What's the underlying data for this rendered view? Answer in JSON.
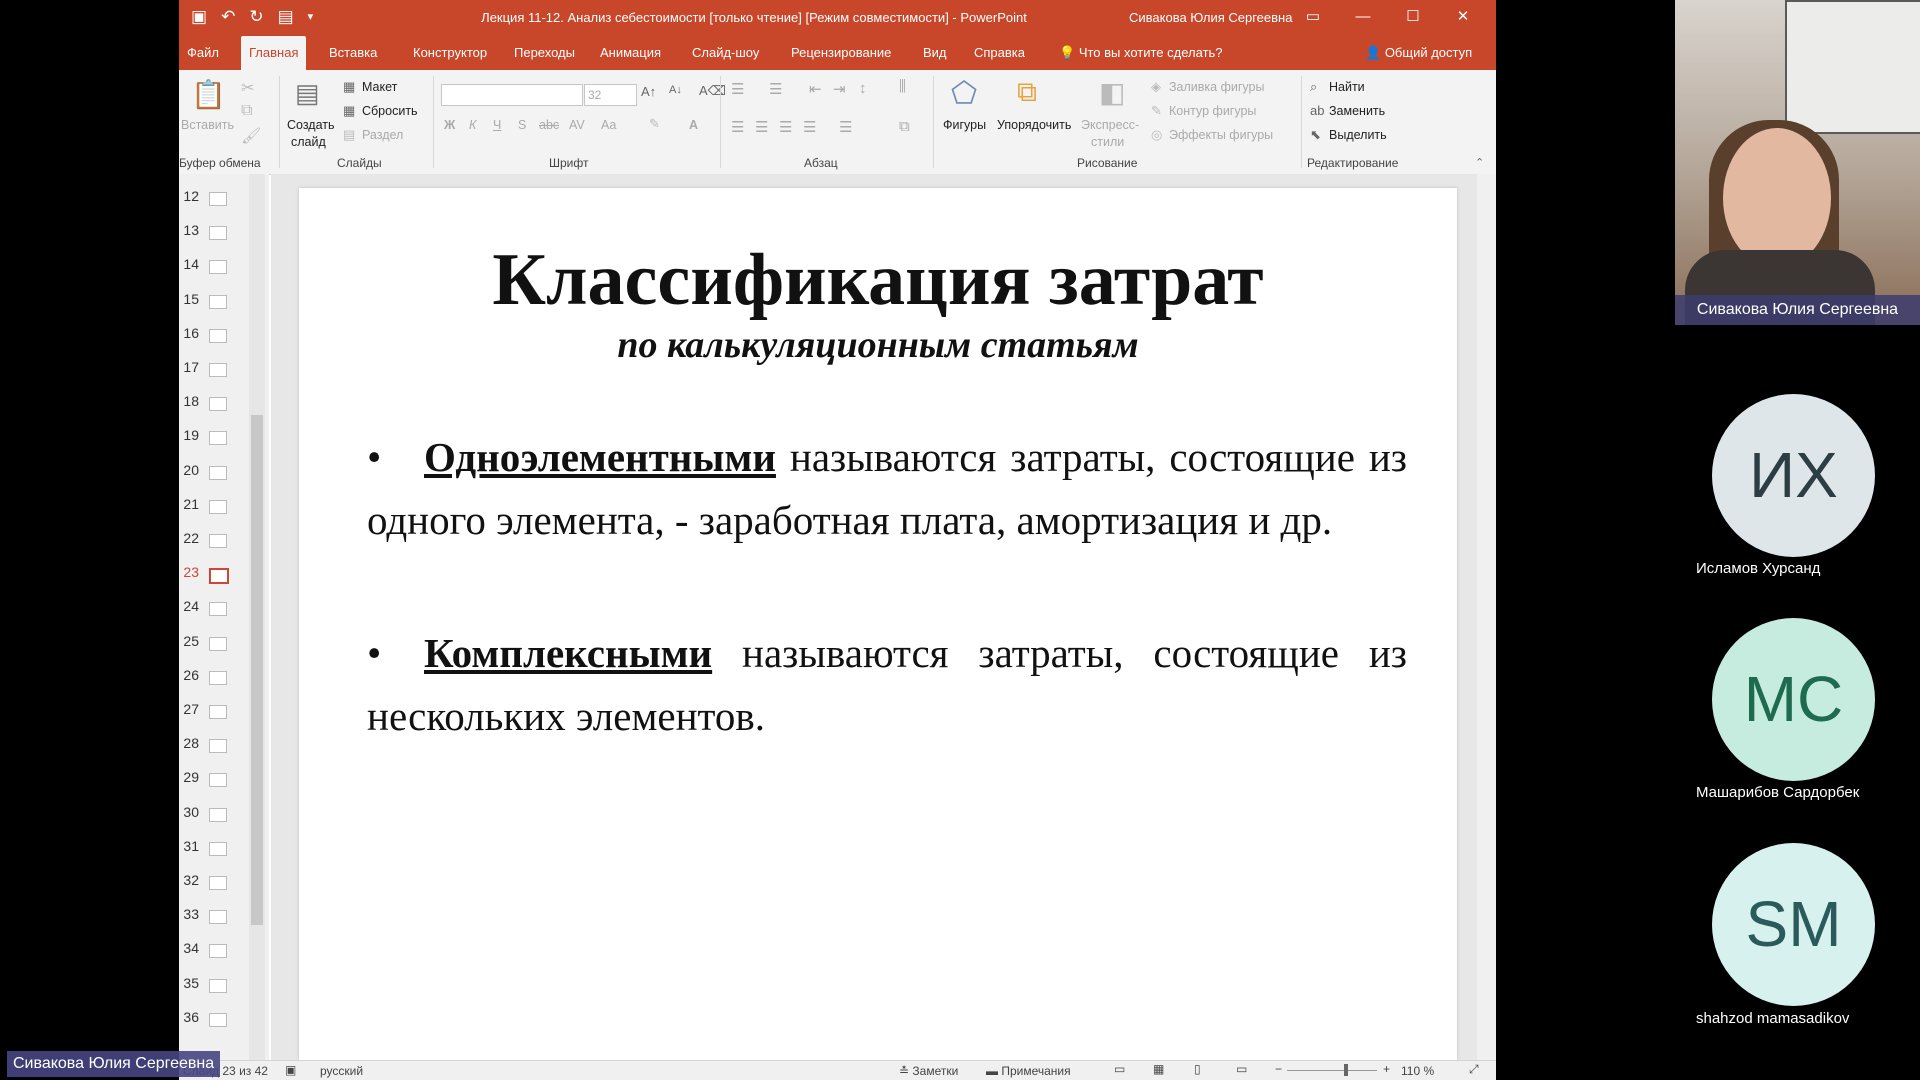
{
  "window": {
    "title": "Лекция 11-12. Анализ себестоимости [только чтение] [Режим совместимости]  -  PowerPoint",
    "user": "Сивакова Юлия Сергеевна",
    "brand_color": "#c8472b"
  },
  "menu": {
    "tabs": [
      "Файл",
      "Главная",
      "Вставка",
      "Конструктор",
      "Переходы",
      "Анимация",
      "Слайд-шоу",
      "Рецензирование",
      "Вид",
      "Справка"
    ],
    "active": "Главная",
    "tell_me": "Что вы хотите сделать?",
    "share": "Общий доступ"
  },
  "ribbon": {
    "clipboard": {
      "paste": "Вставить",
      "label": "Буфер обмена"
    },
    "slides": {
      "new_slide_1": "Создать",
      "new_slide_2": "слайд",
      "layout": "Макет",
      "reset": "Сбросить",
      "section": "Раздел",
      "label": "Слайды"
    },
    "font": {
      "size": "32",
      "label": "Шрифт",
      "bold": "Ж",
      "italic": "К",
      "underline": "Ч",
      "shadow": "S",
      "strike": "abc",
      "spacing": "AV",
      "case": "Aa",
      "color": "A"
    },
    "paragraph": {
      "label": "Абзац"
    },
    "drawing": {
      "shapes": "Фигуры",
      "arrange": "Упорядочить",
      "quick_styles_1": "Экспресс-",
      "quick_styles_2": "стили",
      "fill": "Заливка фигуры",
      "outline": "Контур фигуры",
      "effects": "Эффекты фигуры",
      "label": "Рисование"
    },
    "editing": {
      "find": "Найти",
      "replace": "Заменить",
      "select": "Выделить",
      "label": "Редактирование"
    }
  },
  "thumbnails": {
    "numbers": [
      "12",
      "13",
      "14",
      "15",
      "16",
      "17",
      "18",
      "19",
      "20",
      "21",
      "22",
      "23",
      "24",
      "25",
      "26",
      "27",
      "28",
      "29",
      "30",
      "31",
      "32",
      "33",
      "34",
      "35",
      "36"
    ],
    "selected": "23"
  },
  "slide": {
    "title": "Классификация затрат",
    "subtitle": "по калькуляционным статьям",
    "bullet1_term": "Одноэлементными",
    "bullet1_text": "называются затраты, состоящие из одного элемента, - заработная плата, амортизация и др.",
    "bullet2_term": "Комплексными",
    "bullet2_text": "называются затраты, состоящие из нескольких элементов."
  },
  "status": {
    "slide_of": "Слайд 23 из 42",
    "language": "русский",
    "notes": "Заметки",
    "comments": "Примечания",
    "zoom": "110 %"
  },
  "participants": {
    "presenter": "Сивакова Юлия Сергеевна",
    "list": [
      {
        "initials": "ИХ",
        "name": "Исламов Хурсанд",
        "bg": "#dfe6ea",
        "fg": "#2c3e44"
      },
      {
        "initials": "MC",
        "name": "Машарибов Сардорбек",
        "bg": "#c6ece0",
        "fg": "#1e6b50"
      },
      {
        "initials": "SM",
        "name": "shahzod mamasadikov",
        "bg": "#d6f1ee",
        "fg": "#2b5a5a"
      }
    ]
  },
  "bottom_label": "Сивакова Юлия Сергеевна"
}
